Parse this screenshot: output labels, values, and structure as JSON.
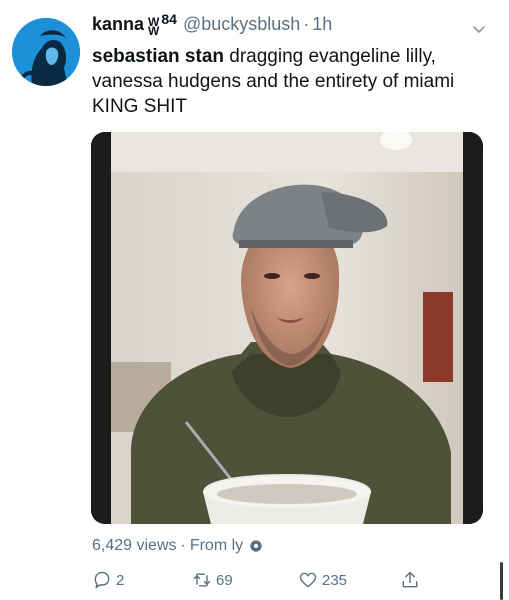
{
  "tweet": {
    "display_name": "kanna",
    "name_badge": [
      "W",
      "W",
      "84"
    ],
    "handle": "@buckysblush",
    "dot": "·",
    "time": "1h",
    "text_bold": "sebastian stan",
    "text_rest": " dragging evangeline lilly, vanessa hudgens and the entirety of miami KING SHIT"
  },
  "meta": {
    "views": "6,429 views",
    "sep": "·",
    "source": "From ly"
  },
  "actions": {
    "replies": "2",
    "retweets": "69",
    "likes": "235"
  },
  "icons": {
    "menu": "chevron-down-icon",
    "reply": "reply-icon",
    "retweet": "retweet-icon",
    "like": "heart-icon",
    "share": "share-icon",
    "source": "gear-icon"
  },
  "colors": {
    "text": "#0f1419",
    "secondary": "#5b7083",
    "avatar_bg": "#1e90d8"
  }
}
